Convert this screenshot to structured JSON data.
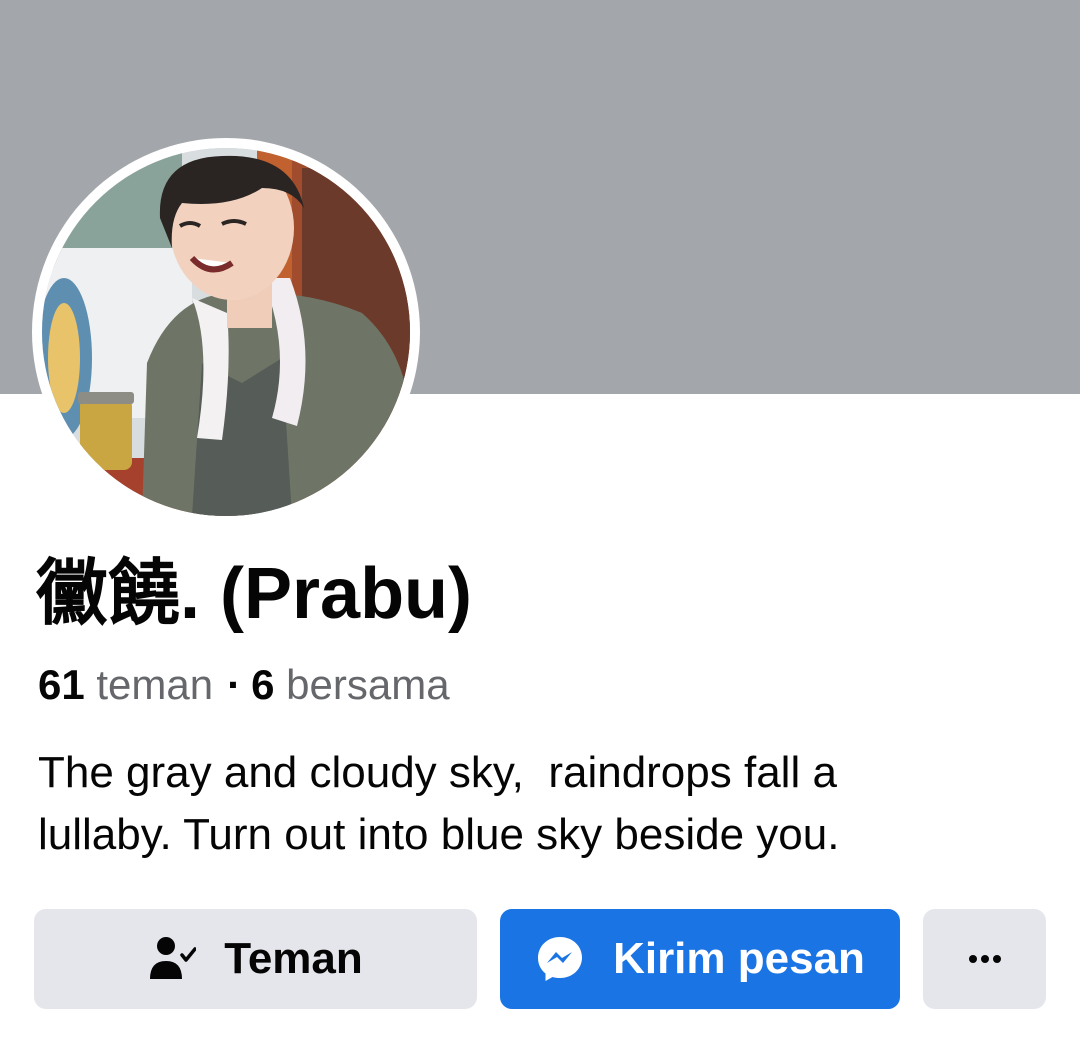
{
  "profile": {
    "name": "黴饒. (Prabu)",
    "friends_count": "61",
    "friends_label": "teman",
    "separator": "·",
    "mutual_count": "6",
    "mutual_label": "bersama",
    "bio_lines": [
      "The gray and cloudy sky,  raindrops fall a",
      "lullaby. Turn out into blue sky beside you."
    ]
  },
  "actions": {
    "friend_label": "Teman",
    "message_label": "Kirim pesan",
    "friend_icon": "person-check-icon",
    "message_icon": "messenger-icon",
    "more_icon": "more-horizontal-icon"
  },
  "colors": {
    "cover": "#a3a6aa",
    "primary": "#1b74e4",
    "secondary_button": "#e4e6eb",
    "text": "#050505",
    "muted_text": "#65676b"
  }
}
